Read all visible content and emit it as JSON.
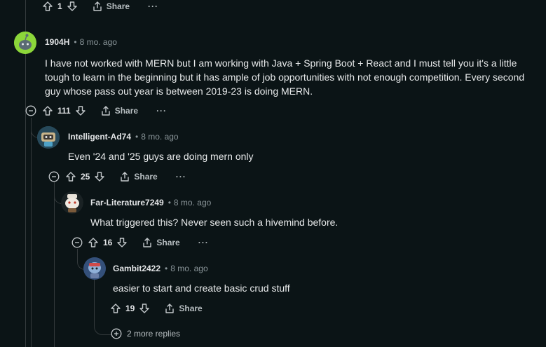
{
  "top_actions": {
    "count": "1",
    "share_label": "Share",
    "more_label": "···"
  },
  "comments": [
    {
      "user": "1904H",
      "sep": "•",
      "time": "8 mo. ago",
      "body": "I have not worked with MERN but I am working with Java + Spring Boot + React and I must tell you it's a little tough to learn in the beginning but it has ample of job opportunities with not enough competition. Every second guy whose pass out year is between 2019-23 is doing MERN.",
      "votes": "111",
      "share_label": "Share",
      "more_label": "···"
    },
    {
      "user": "Intelligent-Ad74",
      "sep": "•",
      "time": "8 mo. ago",
      "body": "Even '24 and '25 guys are doing mern only",
      "votes": "25",
      "share_label": "Share",
      "more_label": "···"
    },
    {
      "user": "Far-Literature7249",
      "sep": "•",
      "time": "8 mo. ago",
      "body": "What triggered this? Never seen such a hivemind before.",
      "votes": "16",
      "share_label": "Share",
      "more_label": "···"
    },
    {
      "user": "Gambit2422",
      "sep": "•",
      "time": "8 mo. ago",
      "body": "easier to start and create basic crud stuff",
      "votes": "19",
      "share_label": "Share"
    }
  ],
  "more_replies_label": "2 more replies",
  "colors": {
    "background": "#0b1416",
    "thread_line": "#343a3c",
    "muted": "#8a9599"
  }
}
